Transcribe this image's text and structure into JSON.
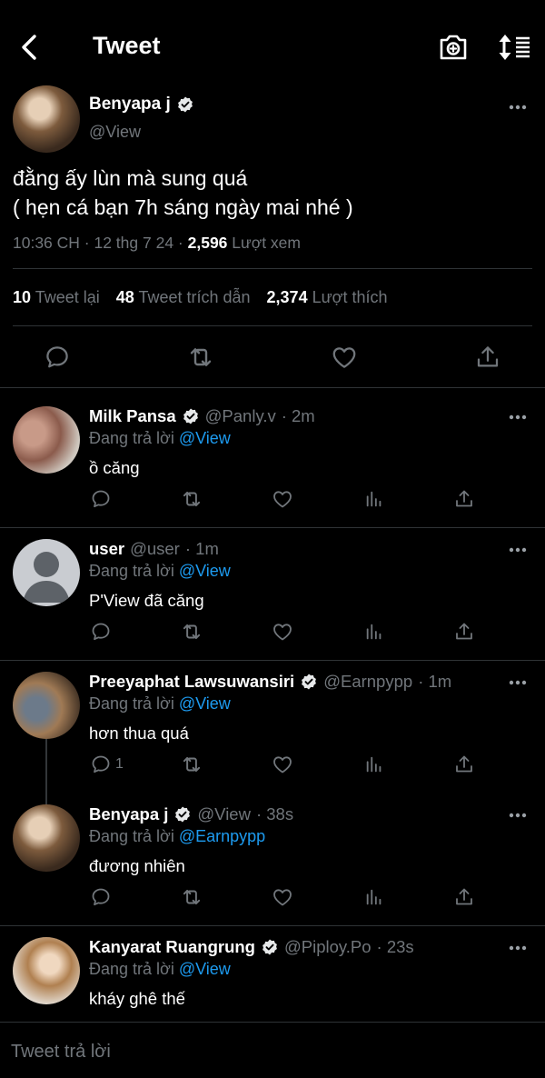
{
  "header": {
    "title": "Tweet",
    "back_icon": "chevron-left-icon",
    "camera_icon": "camera-plus-icon",
    "sort_icon": "sort-icon"
  },
  "main_tweet": {
    "name": "Benyapa j",
    "handle": "@View",
    "text": "đằng ấy lùn mà sung quá\n( hẹn cá bạn 7h sáng ngày mai nhé )",
    "time": "10:36 CH · 12 thg 7 24 · ",
    "views_count": "2,596",
    "views_label": " Lượt xem",
    "retweets_count": "10",
    "retweets_label": " Tweet lại",
    "quotes_count": "48",
    "quotes_label": " Tweet trích dẫn",
    "likes_count": "2,374",
    "likes_label": " Lượt thích"
  },
  "reply_prefix": "Đang trả lời ",
  "replies": [
    {
      "name": "Milk Pansa",
      "handle": "@Panly.v",
      "time": " · 2m",
      "replying_to": "@View",
      "text": "ồ căng",
      "verified": true,
      "reply_count": ""
    },
    {
      "name": "user",
      "handle": "@user",
      "time": " · 1m",
      "replying_to": "@View",
      "text": "P'View đã căng",
      "verified": false,
      "reply_count": ""
    },
    {
      "name": "Preeyaphat Lawsuwansiri",
      "handle": "@Earnpypp",
      "time": " · 1m",
      "replying_to": "@View",
      "text": "hơn thua quá",
      "verified": true,
      "reply_count": "1"
    },
    {
      "name": "Benyapa j",
      "handle": "@View",
      "time": " · 38s",
      "replying_to": "@Earnpypp",
      "text": "đương nhiên",
      "verified": true,
      "reply_count": ""
    },
    {
      "name": "Kanyarat Ruangrung",
      "handle": "@Piploy.Po",
      "time": " · 23s",
      "replying_to": "@View",
      "text": "kháy ghê thế",
      "verified": true,
      "reply_count": ""
    }
  ],
  "compose": {
    "placeholder": "Tweet trả lời"
  },
  "colors": {
    "background": "#000000",
    "text": "#e7e9ea",
    "muted": "#71767b",
    "link": "#1d9bf0",
    "divider": "#2f3336"
  }
}
